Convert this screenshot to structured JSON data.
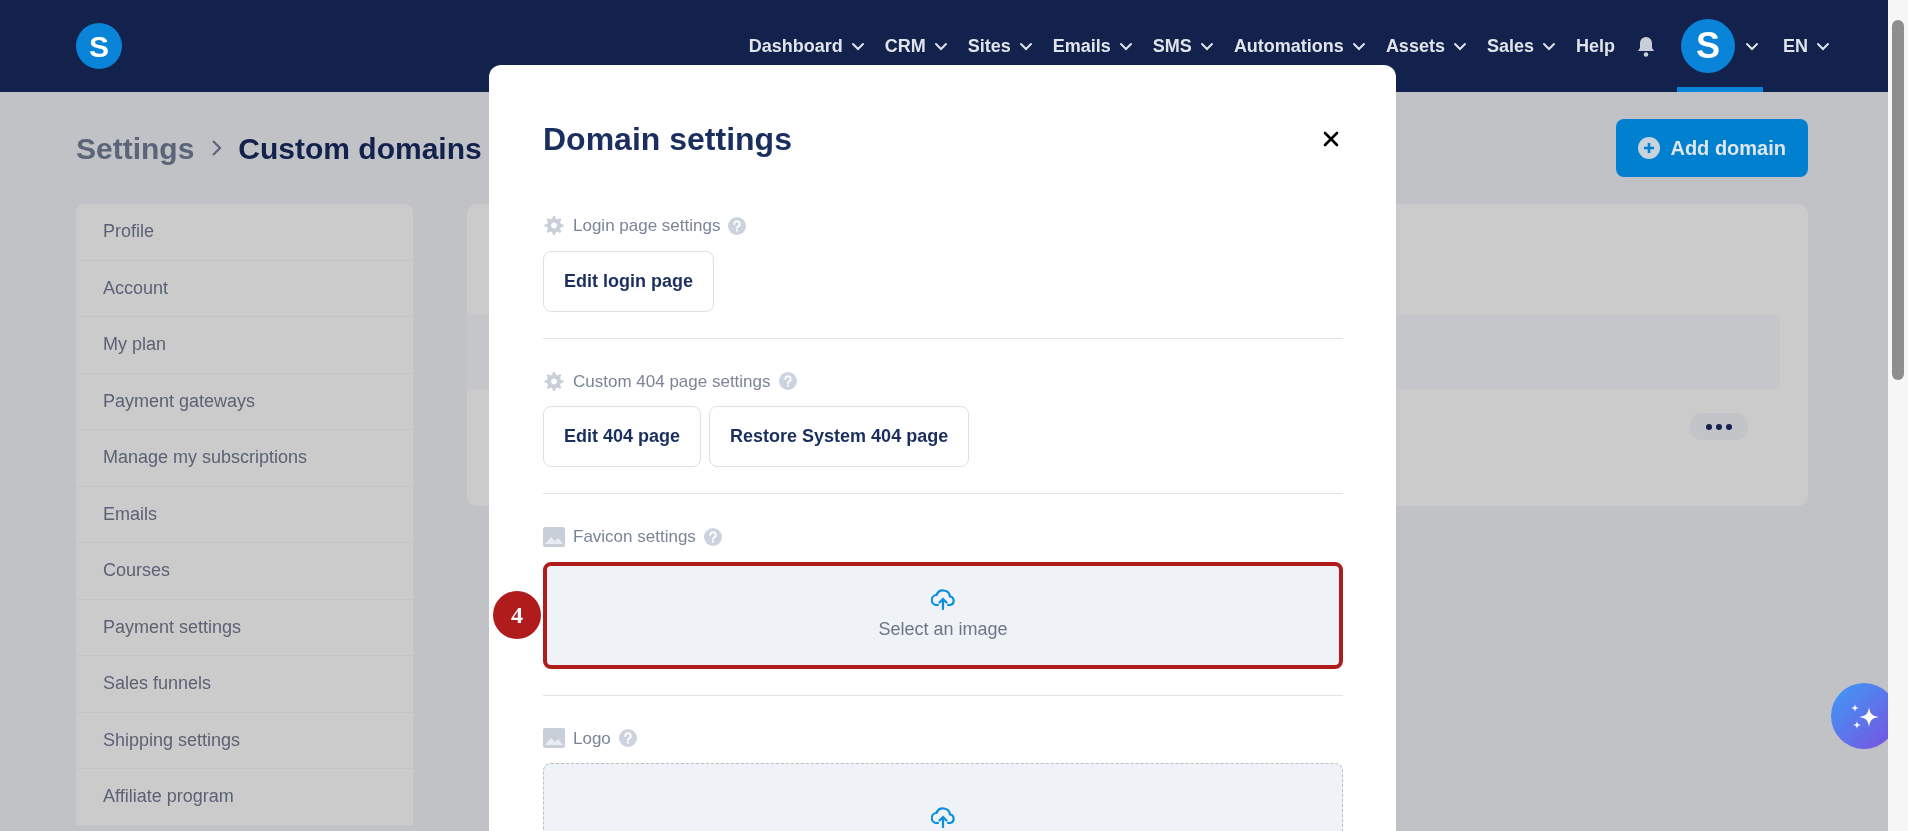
{
  "navbar": {
    "logo_letter": "S",
    "menu": [
      {
        "label": "Dashboard",
        "dropdown": true
      },
      {
        "label": "CRM",
        "dropdown": true
      },
      {
        "label": "Sites",
        "dropdown": true
      },
      {
        "label": "Emails",
        "dropdown": true
      },
      {
        "label": "SMS",
        "dropdown": true
      },
      {
        "label": "Automations",
        "dropdown": true
      },
      {
        "label": "Assets",
        "dropdown": true
      },
      {
        "label": "Sales",
        "dropdown": true
      },
      {
        "label": "Help",
        "dropdown": false
      }
    ],
    "avatar": {
      "letter": "S",
      "selected": true
    },
    "language": "EN"
  },
  "breadcrumb": [
    "Settings",
    "Custom domains"
  ],
  "add_button": "Add domain",
  "sidebar": {
    "items": [
      "Profile",
      "Account",
      "My plan",
      "Payment gateways",
      "Manage my subscriptions",
      "Emails",
      "Courses",
      "Payment settings",
      "Sales funnels",
      "Shipping settings",
      "Affiliate program"
    ]
  },
  "modal": {
    "title": "Domain settings",
    "sections": [
      {
        "kind": "buttons",
        "label": "Login page settings",
        "buttons": [
          "Edit login page"
        ]
      },
      {
        "kind": "buttons",
        "label": "Custom 404 page settings",
        "buttons": [
          "Edit 404 page",
          "Restore System 404 page"
        ]
      },
      {
        "kind": "upload",
        "label": "Favicon settings",
        "text": "Select an image",
        "highlighted": true,
        "step": "4"
      },
      {
        "kind": "upload",
        "label": "Logo",
        "highlighted": false
      }
    ]
  }
}
